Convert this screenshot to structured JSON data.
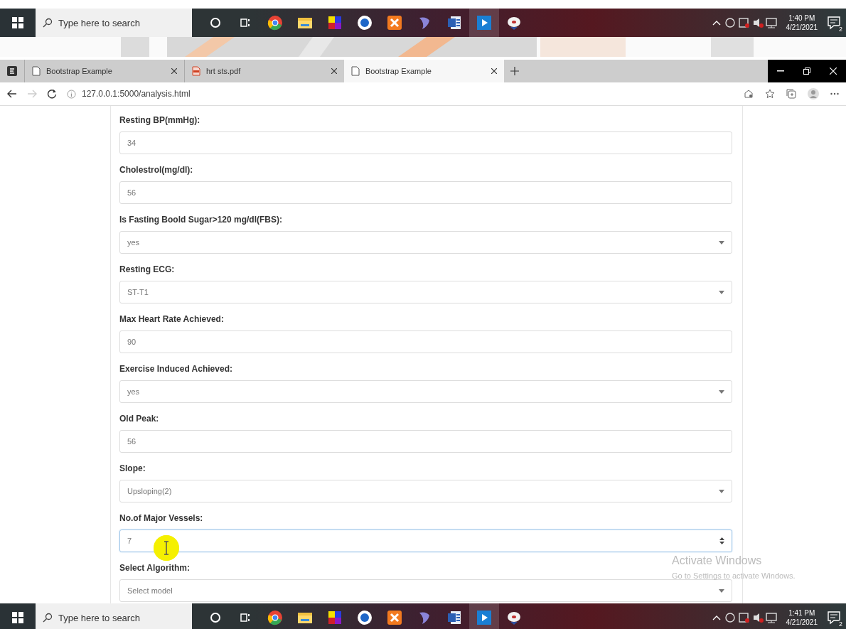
{
  "taskbar_top": {
    "search_placeholder": "Type here to search",
    "time": "1:40 PM",
    "date": "4/21/2021",
    "notification_count": "2"
  },
  "browser": {
    "tabs": [
      {
        "title": "Bootstrap Example",
        "kind": "page",
        "selected": false
      },
      {
        "title": "hrt sts.pdf",
        "kind": "pdf",
        "selected": false
      },
      {
        "title": "Bootstrap Example",
        "kind": "page",
        "selected": true
      }
    ],
    "address": "127.0.0.1:5000/analysis.html"
  },
  "form": {
    "fields": [
      {
        "label": "Resting BP(mmHg):",
        "kind": "text",
        "value": "34",
        "focused": false
      },
      {
        "label": "Cholestrol(mg/dl):",
        "kind": "text",
        "value": "56",
        "focused": false
      },
      {
        "label": "Is Fasting Boold Sugar>120 mg/dl(FBS):",
        "kind": "select",
        "value": "yes",
        "focused": false
      },
      {
        "label": "Resting ECG:",
        "kind": "select",
        "value": "ST-T1",
        "focused": false
      },
      {
        "label": "Max Heart Rate Achieved:",
        "kind": "text",
        "value": "90",
        "focused": false
      },
      {
        "label": "Exercise Induced Achieved:",
        "kind": "select",
        "value": "yes",
        "focused": false
      },
      {
        "label": "Old Peak:",
        "kind": "text",
        "value": "56",
        "focused": false
      },
      {
        "label": "Slope:",
        "kind": "select",
        "value": "Upsloping(2)",
        "focused": false
      },
      {
        "label": "No.of Major Vessels:",
        "kind": "number",
        "value": "7",
        "focused": true
      },
      {
        "label": "Select Algorithm:",
        "kind": "select",
        "value": "Select model",
        "focused": false
      }
    ]
  },
  "activation_notice": {
    "title": "Activate Windows",
    "subtitle": "Go to Settings to activate Windows."
  },
  "taskbar_bottom": {
    "search_placeholder": "Type here to search",
    "time": "1:41 PM",
    "date": "4/21/2021",
    "notification_count": "2"
  }
}
